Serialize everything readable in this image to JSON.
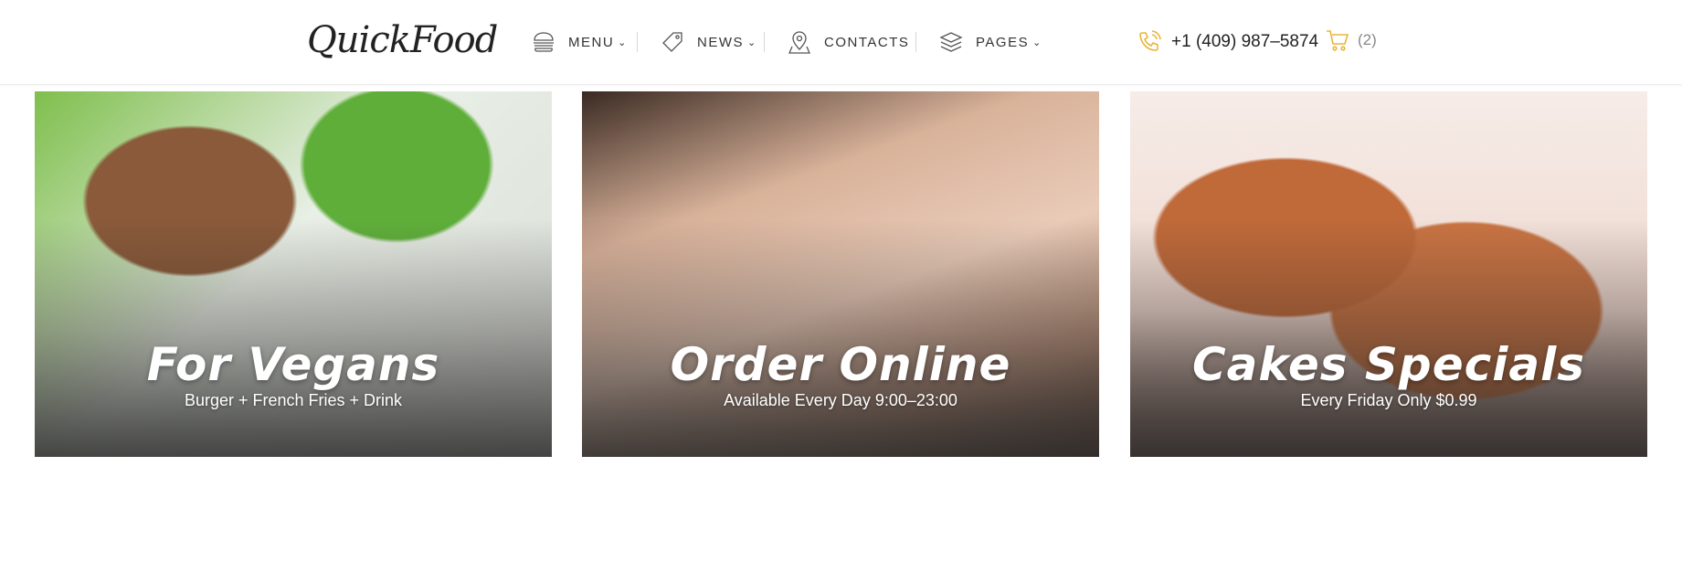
{
  "brand": {
    "logo_text": "QuickFood"
  },
  "nav": {
    "menu_label": "MENU",
    "news_label": "NEWS",
    "contacts_label": "CONTACTS",
    "pages_label": "PAGES",
    "chevron": "⌄"
  },
  "header": {
    "phone": "+1 (409) 987–5874",
    "cart_count": "(2)"
  },
  "cards": [
    {
      "title": "For Vegans",
      "subtitle": "Burger + French Fries + Drink"
    },
    {
      "title": "Order Online",
      "subtitle": "Available Every Day 9:00–23:00"
    },
    {
      "title": "Cakes Specials",
      "subtitle": "Every Friday Only $0.99"
    }
  ],
  "colors": {
    "accent": "#e8b53a",
    "logo_dot": "#e0473b",
    "text": "#333333"
  }
}
